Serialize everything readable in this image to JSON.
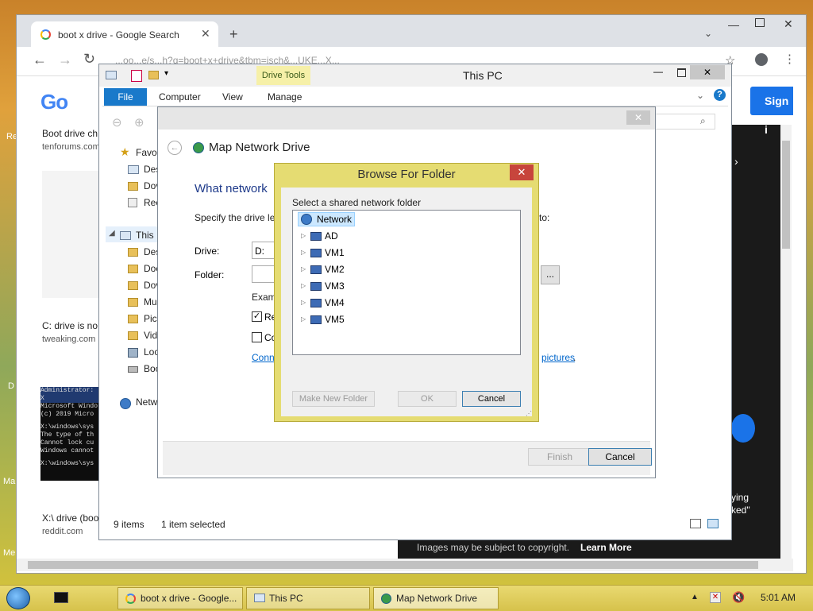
{
  "browser": {
    "tab_title": "boot x drive - Google Search",
    "new_tab": "+",
    "address_partial": "...oo...e/s...h?q=boot+x+drive&tbm=isch&...UKE...X...",
    "results": [
      {
        "title": "Boot drive ch",
        "site": "tenforums.com"
      },
      {
        "title": "C: drive is no",
        "site": "tweaking.com"
      },
      {
        "title": "X:\\ drive (boo",
        "site": "reddit.com"
      }
    ],
    "cmd_lines": [
      "Administrator: X",
      "Microsoft Windo",
      "(c) 2019 Micro",
      "",
      "X:\\windows\\sys",
      "The type of th",
      "Cannot lock cu",
      "Windows cannot",
      "",
      "X:\\windows\\sys"
    ],
    "sign_in": "Sign i",
    "copyright": "Images may be subject to copyright.",
    "learn_more": "Learn More",
    "side_text": [
      "ying",
      "ked\""
    ]
  },
  "explorer": {
    "title": "This PC",
    "drive_tools": "Drive Tools",
    "tabs": {
      "file": "File",
      "computer": "Computer",
      "view": "View",
      "manage": "Manage"
    },
    "nav": [
      {
        "label": "Favo",
        "kind": "star"
      },
      {
        "label": "Des",
        "kind": "desktop"
      },
      {
        "label": "Dov",
        "kind": "folder"
      },
      {
        "label": "Rec",
        "kind": "recent"
      },
      {
        "label": "This I",
        "kind": "pc"
      },
      {
        "label": "Des",
        "kind": "folder"
      },
      {
        "label": "Doc",
        "kind": "folder"
      },
      {
        "label": "Dov",
        "kind": "folder"
      },
      {
        "label": "Mu",
        "kind": "folder"
      },
      {
        "label": "Pict",
        "kind": "folder"
      },
      {
        "label": "Vid",
        "kind": "folder"
      },
      {
        "label": "Loc",
        "kind": "drive"
      },
      {
        "label": "Boc",
        "kind": "drive"
      },
      {
        "label": "Netw",
        "kind": "network"
      }
    ],
    "status_items": "9 items",
    "status_selected": "1 item selected"
  },
  "map_drive": {
    "title": "Map Network Drive",
    "heading": "What network",
    "specify": "Specify the drive let",
    "specify_tail": "to:",
    "drive_label": "Drive:",
    "drive_value": "D:",
    "folder_label": "Folder:",
    "browse_label": "...",
    "example": "Exam",
    "reconnect": "Re",
    "connect_creds": "Co",
    "link_left": "Conn",
    "link_right": "pictures",
    "link_dot": ".",
    "finish": "Finish",
    "cancel": "Cancel"
  },
  "browse_folder": {
    "title": "Browse For Folder",
    "close": "✕",
    "instruction": "Select a shared network folder",
    "root": "Network",
    "nodes": [
      "AD",
      "VM1",
      "VM2",
      "VM3",
      "VM4",
      "VM5"
    ],
    "make_new_folder": "Make New Folder",
    "ok": "OK",
    "cancel": "Cancel"
  },
  "taskbar": {
    "items": [
      "boot x drive - Google...",
      "This PC",
      "Map Network Drive"
    ],
    "clock": "5:01 AM"
  },
  "desktop_labels": [
    "Re",
    "D",
    "Ma",
    "Me"
  ]
}
